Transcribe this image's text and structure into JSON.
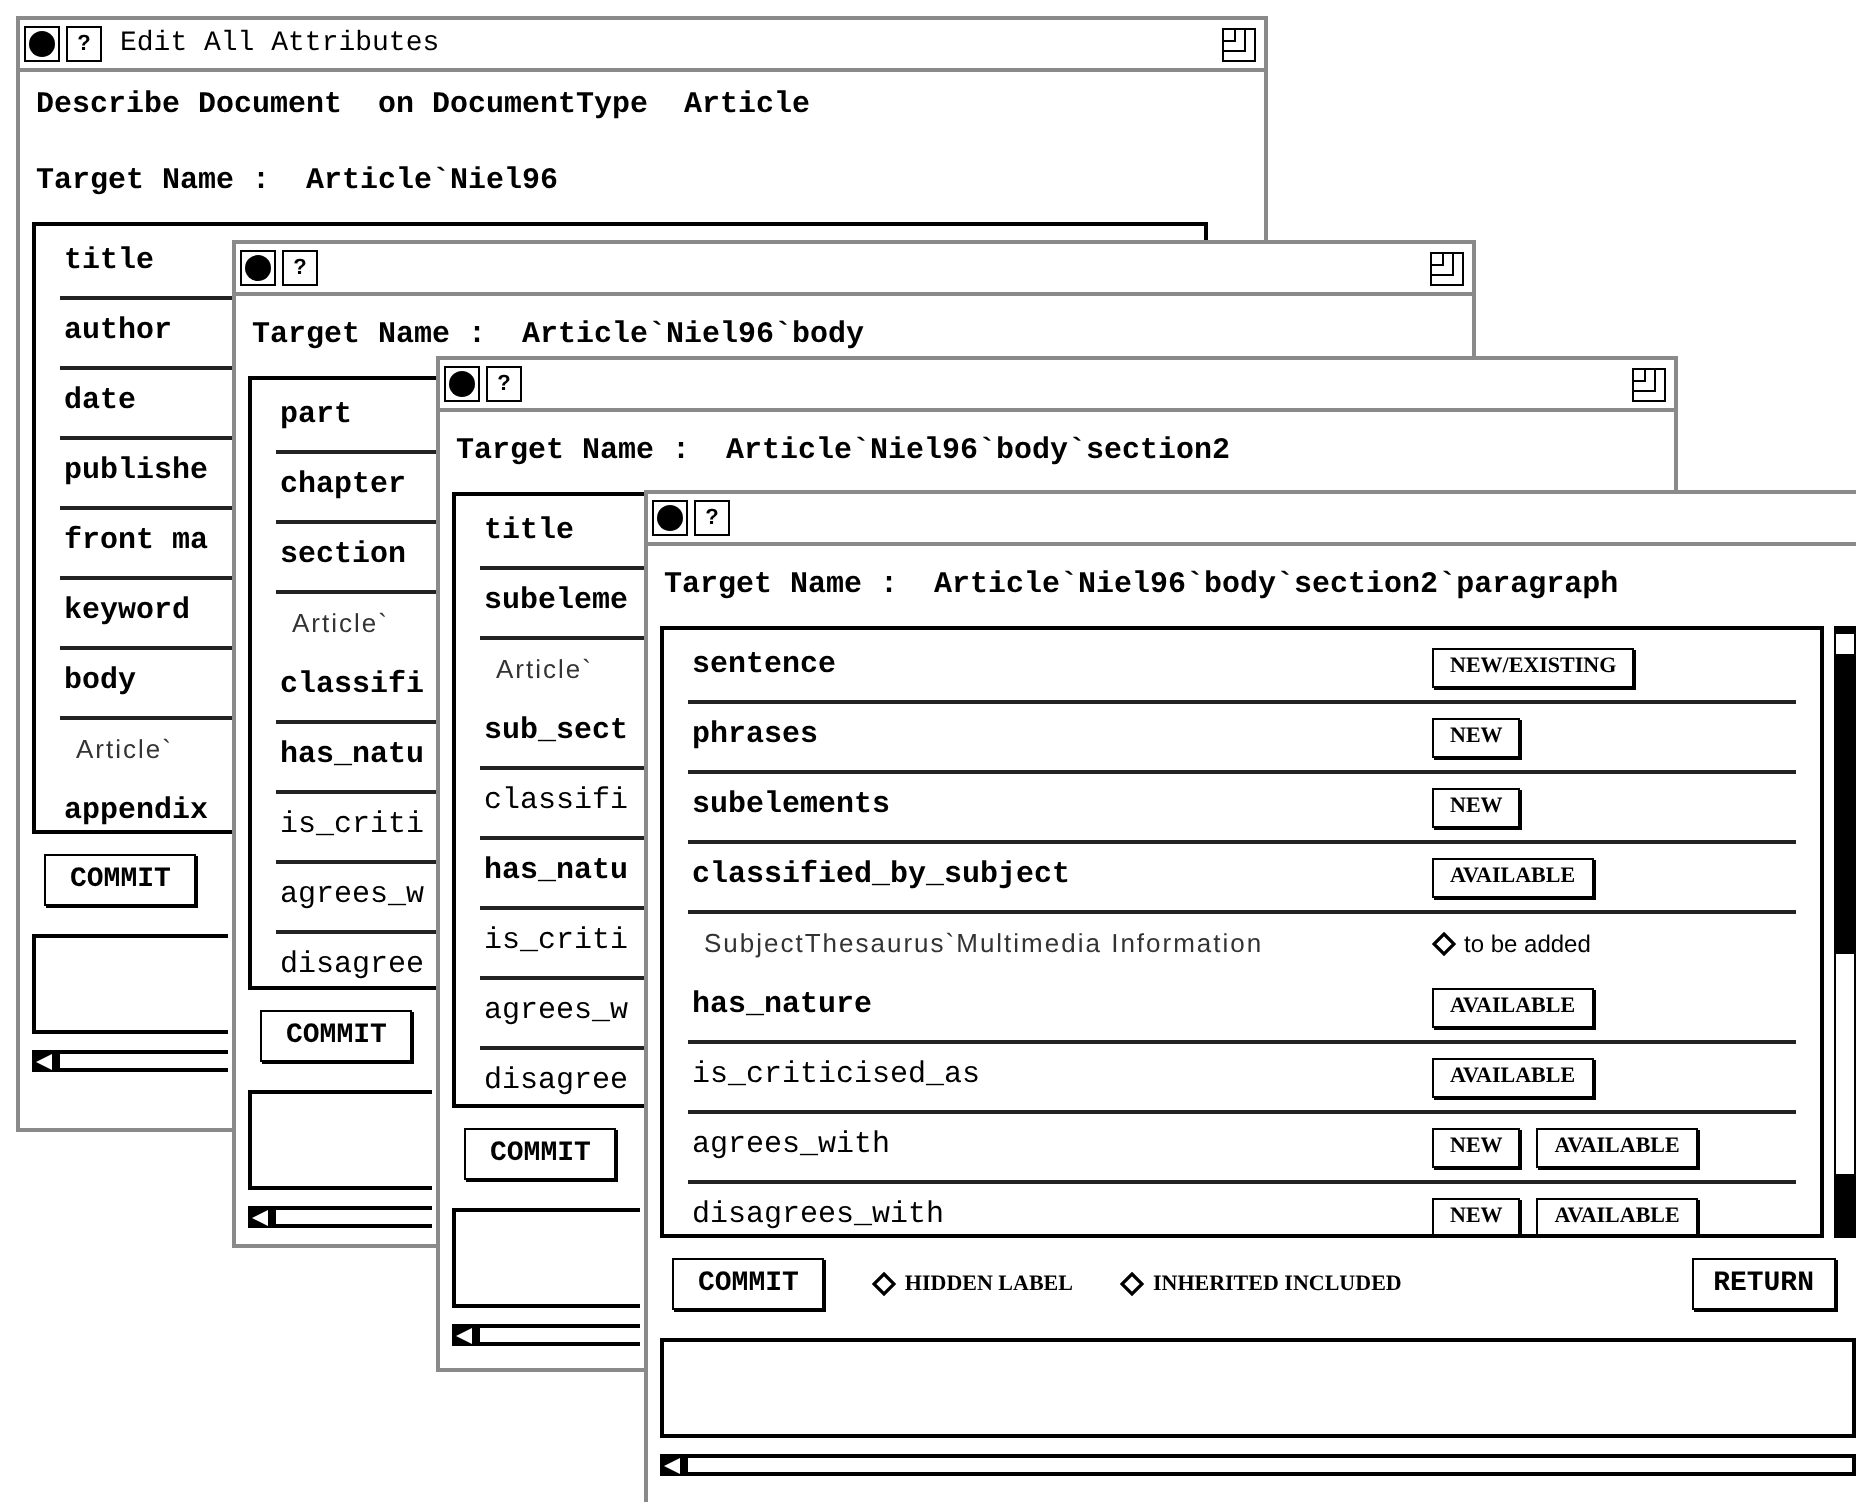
{
  "windows": [
    {
      "title": "Edit All Attributes",
      "help": "?",
      "heading": "Describe Document  on DocumentType  Article",
      "target": "Target Name :  Article`Niel96",
      "rows": [
        {
          "kind": "attribute",
          "label": "title"
        },
        {
          "kind": "attribute",
          "label": "author"
        },
        {
          "kind": "attribute",
          "label": "date"
        },
        {
          "kind": "attribute",
          "label": "publishe"
        },
        {
          "kind": "attribute",
          "label": "front ma"
        },
        {
          "kind": "attribute",
          "label": "keyword"
        },
        {
          "kind": "attribute",
          "label": "body"
        },
        {
          "kind": "value",
          "label": "Article`"
        },
        {
          "kind": "attribute",
          "label": "appendix"
        }
      ],
      "commit": "COMMIT"
    },
    {
      "help": "?",
      "target": "Target Name :  Article`Niel96`body",
      "rows": [
        {
          "kind": "attribute",
          "label": "part"
        },
        {
          "kind": "attribute",
          "label": "chapter"
        },
        {
          "kind": "attribute",
          "label": "section"
        },
        {
          "kind": "value",
          "label": "Article`"
        },
        {
          "kind": "attribute",
          "label": "classifi"
        },
        {
          "kind": "attribute",
          "label": "has_natu"
        },
        {
          "kind": "relation",
          "label": "is_criti"
        },
        {
          "kind": "relation",
          "label": "agrees_w"
        },
        {
          "kind": "relation",
          "label": "disagree"
        }
      ],
      "commit": "COMMIT"
    },
    {
      "help": "?",
      "target": "Target Name :  Article`Niel96`body`section2",
      "rows": [
        {
          "kind": "attribute",
          "label": "title"
        },
        {
          "kind": "attribute",
          "label": "subeleme"
        },
        {
          "kind": "value",
          "label": "Article`"
        },
        {
          "kind": "attribute",
          "label": "sub_sect"
        },
        {
          "kind": "relation",
          "label": "classifi"
        },
        {
          "kind": "attribute",
          "label": "has_natu"
        },
        {
          "kind": "relation",
          "label": "is_criti"
        },
        {
          "kind": "relation",
          "label": "agrees_w"
        },
        {
          "kind": "relation",
          "label": "disagree"
        }
      ],
      "commit": "COMMIT"
    },
    {
      "help": "?",
      "target": "Target Name :  Article`Niel96`body`section2`paragraph",
      "rows": [
        {
          "kind": "attribute",
          "label": "sentence",
          "buttons": [
            "NEW/EXISTING"
          ]
        },
        {
          "kind": "attribute",
          "label": "phrases",
          "buttons": [
            "NEW"
          ]
        },
        {
          "kind": "attribute",
          "label": "subelements",
          "buttons": [
            "NEW"
          ]
        },
        {
          "kind": "attribute",
          "label": "classified_by_subject",
          "buttons": [
            "AVAILABLE"
          ]
        },
        {
          "kind": "value",
          "label": "SubjectThesaurus`Multimedia Information",
          "choice": {
            "label": "to be added",
            "selected": false
          }
        },
        {
          "kind": "attribute",
          "label": "has_nature",
          "buttons": [
            "AVAILABLE"
          ]
        },
        {
          "kind": "relation",
          "label": "is_criticised_as",
          "buttons": [
            "AVAILABLE"
          ]
        },
        {
          "kind": "relation",
          "label": "agrees_with",
          "buttons": [
            "NEW",
            "AVAILABLE"
          ]
        },
        {
          "kind": "relation",
          "label": "disagrees_with",
          "buttons": [
            "NEW",
            "AVAILABLE"
          ]
        }
      ],
      "commit": "COMMIT",
      "options": [
        {
          "label": "HIDDEN LABEL",
          "checked": false
        },
        {
          "label": "INHERITED INCLUDED",
          "checked": false
        }
      ],
      "return": "RETURN"
    }
  ]
}
